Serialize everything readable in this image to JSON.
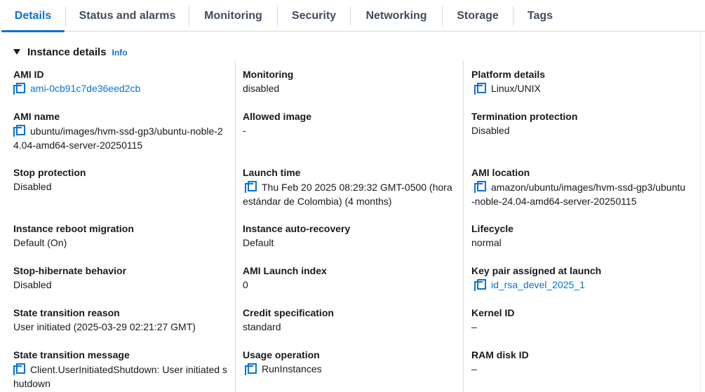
{
  "tabs": [
    {
      "label": "Details"
    },
    {
      "label": "Status and alarms"
    },
    {
      "label": "Monitoring"
    },
    {
      "label": "Security"
    },
    {
      "label": "Networking"
    },
    {
      "label": "Storage"
    },
    {
      "label": "Tags"
    }
  ],
  "active_tab": "Details",
  "section": {
    "title": "Instance details",
    "info": "Info"
  },
  "fields": {
    "ami_id": {
      "label": "AMI ID",
      "value": "ami-0cb91c7de36eed2cb"
    },
    "ami_name": {
      "label": "AMI name",
      "value": "ubuntu/images/hvm-ssd-gp3/ubuntu-noble-24.04-amd64-server-20250115"
    },
    "stop_protection": {
      "label": "Stop protection",
      "value": "Disabled"
    },
    "reboot_migration": {
      "label": "Instance reboot migration",
      "value": "Default (On)"
    },
    "stop_hibernate": {
      "label": "Stop-hibernate behavior",
      "value": "Disabled"
    },
    "state_reason": {
      "label": "State transition reason",
      "value": "User initiated (2025-03-29 02:21:27 GMT)"
    },
    "state_message": {
      "label": "State transition message",
      "value": "Client.UserInitiatedShutdown: User initiated shutdown"
    },
    "monitoring": {
      "label": "Monitoring",
      "value": "disabled"
    },
    "allowed_image": {
      "label": "Allowed image",
      "value": "-"
    },
    "launch_time": {
      "label": "Launch time",
      "value": "Thu Feb 20 2025 08:29:32 GMT-0500 (hora estándar de Colombia) (4 months)"
    },
    "auto_recovery": {
      "label": "Instance auto-recovery",
      "value": "Default"
    },
    "ami_launch_index": {
      "label": "AMI Launch index",
      "value": "0"
    },
    "credit_spec": {
      "label": "Credit specification",
      "value": "standard"
    },
    "usage_operation": {
      "label": "Usage operation",
      "value": "RunInstances"
    },
    "platform_details": {
      "label": "Platform details",
      "value": "Linux/UNIX"
    },
    "termination_protection": {
      "label": "Termination protection",
      "value": "Disabled"
    },
    "ami_location": {
      "label": "AMI location",
      "value": "amazon/ubuntu/images/hvm-ssd-gp3/ubuntu-noble-24.04-amd64-server-20250115"
    },
    "lifecycle": {
      "label": "Lifecycle",
      "value": "normal"
    },
    "key_pair": {
      "label": "Key pair assigned at launch",
      "value": "id_rsa_devel_2025_1"
    },
    "kernel_id": {
      "label": "Kernel ID",
      "value": "–"
    },
    "ram_disk_id": {
      "label": "RAM disk ID",
      "value": "–"
    }
  },
  "colors": {
    "accent": "#0972d3",
    "text": "#16191f",
    "tab_text": "#414d5c",
    "divider": "#d5dbdb"
  },
  "icons": {
    "copy": "copy-icon",
    "caret": "caret-down-icon"
  }
}
